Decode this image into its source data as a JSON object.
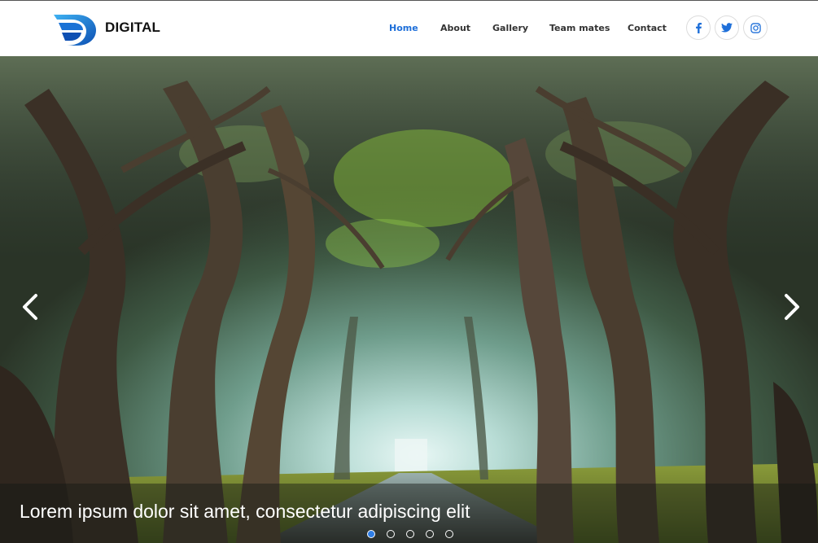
{
  "brand": {
    "name": "DIGITAL",
    "logo_icon": "swoosh-d-logo",
    "accent": "#1e6fd9"
  },
  "nav": {
    "items": [
      {
        "label": "Home",
        "active": true
      },
      {
        "label": "About",
        "active": false
      },
      {
        "label": "Gallery",
        "active": false
      },
      {
        "label": "Team mates",
        "active": false
      },
      {
        "label": "Contact",
        "active": false
      }
    ]
  },
  "social": [
    {
      "icon": "facebook-icon",
      "glyph": "f"
    },
    {
      "icon": "twitter-icon",
      "glyph": "t"
    },
    {
      "icon": "instagram-icon",
      "glyph": "i"
    }
  ],
  "slider": {
    "caption": "Lorem ipsum dolor sit amet, consectetur adipiscing elit",
    "slide_count": 5,
    "active_slide": 1,
    "prev_icon": "chevron-left-icon",
    "next_icon": "chevron-right-icon",
    "dot_active_color": "#2f7ee6"
  }
}
